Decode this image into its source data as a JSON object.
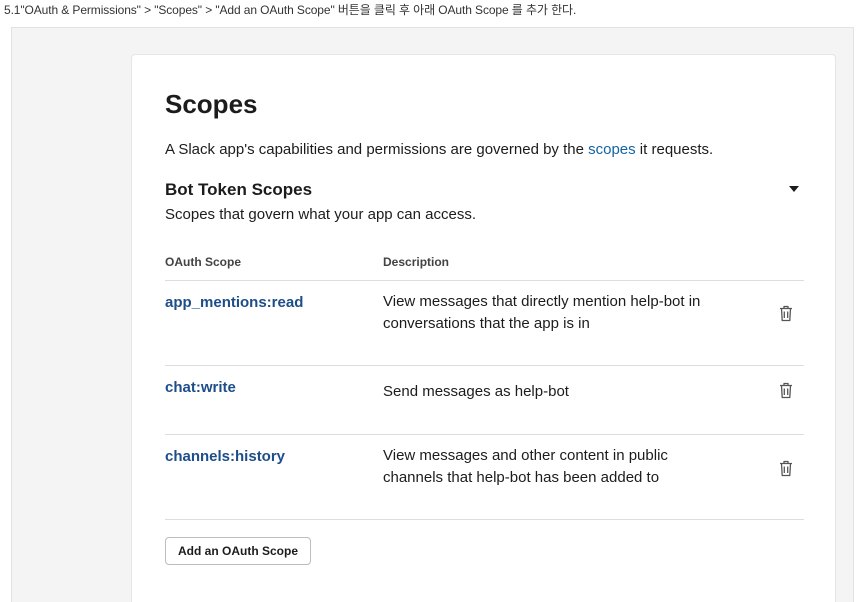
{
  "caption": "5.1\"OAuth & Permissions\"  > \"Scopes\" > \"Add an OAuth Scope\" 버튼을 클릭 후 아래 OAuth Scope 를 추가 한다.",
  "scopes": {
    "title": "Scopes",
    "intro_before": "A Slack app's capabilities and permissions are governed by the ",
    "intro_link": "scopes",
    "intro_after": " it requests."
  },
  "bot_token": {
    "title": "Bot Token Scopes",
    "subtitle": "Scopes that govern what your app can access.",
    "columns": {
      "scope": "OAuth Scope",
      "description": "Description"
    },
    "rows": [
      {
        "scope": "app_mentions:read",
        "description": "View messages that directly mention help-bot in conversations that the app is in"
      },
      {
        "scope": "chat:write",
        "description": "Send messages as help-bot"
      },
      {
        "scope": "channels:history",
        "description": "View messages and other content in public channels that help-bot has been added to"
      }
    ],
    "add_button": "Add an OAuth Scope"
  },
  "icons": {
    "collapse": "caret-down-icon",
    "remove": "trash-icon"
  },
  "colors": {
    "link": "#1264a3",
    "scope_name": "#1d4e89",
    "text": "#1d1c1d",
    "divider": "#dddddd"
  }
}
